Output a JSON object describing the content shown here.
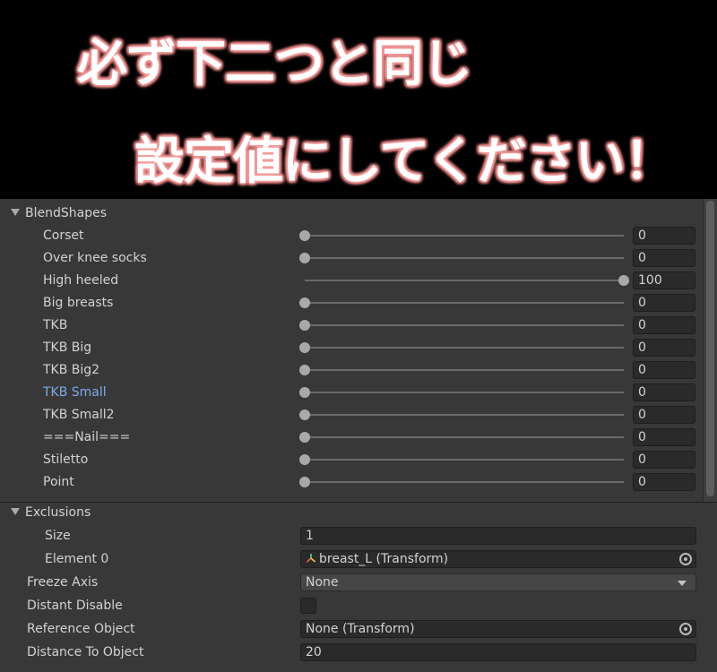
{
  "banner": {
    "line1": "必ず下二つと同じ",
    "line2": "設定値にしてください！"
  },
  "blendshapes": {
    "title": "BlendShapes",
    "items": [
      {
        "label": "Corset",
        "value": "0",
        "level": 0
      },
      {
        "label": "Over knee socks",
        "value": "0",
        "level": 0
      },
      {
        "label": "High heeled",
        "value": "100",
        "level": 1
      },
      {
        "label": "Big breasts",
        "value": "0",
        "level": 0
      },
      {
        "label": "TKB",
        "value": "0",
        "level": 0
      },
      {
        "label": "TKB Big",
        "value": "0",
        "level": 0
      },
      {
        "label": "TKB Big2",
        "value": "0",
        "level": 0
      },
      {
        "label": "TKB Small",
        "value": "0",
        "level": 0
      },
      {
        "label": "TKB Small2",
        "value": "0",
        "level": 0
      },
      {
        "label": "===Nail===",
        "value": "0",
        "level": 0
      },
      {
        "label": "Stiletto",
        "value": "0",
        "level": 0
      },
      {
        "label": "Point",
        "value": "0",
        "level": 0
      }
    ]
  },
  "exclusions": {
    "title": "Exclusions",
    "size_label": "Size",
    "size_value": "1",
    "element0_label": "Element 0",
    "element0_value": "breast_L (Transform)"
  },
  "freeze_axis": {
    "label": "Freeze Axis",
    "value": "None"
  },
  "distant_disable": {
    "label": "Distant Disable"
  },
  "reference_object": {
    "label": "Reference Object",
    "value": "None (Transform)"
  },
  "distance_to_object": {
    "label": "Distance To Object",
    "value": "20"
  },
  "colors": {
    "panel": "#383838",
    "field": "#2a2a2a",
    "highlight_label": "#7ea9e8",
    "banner_glow": "#f08a8a"
  }
}
